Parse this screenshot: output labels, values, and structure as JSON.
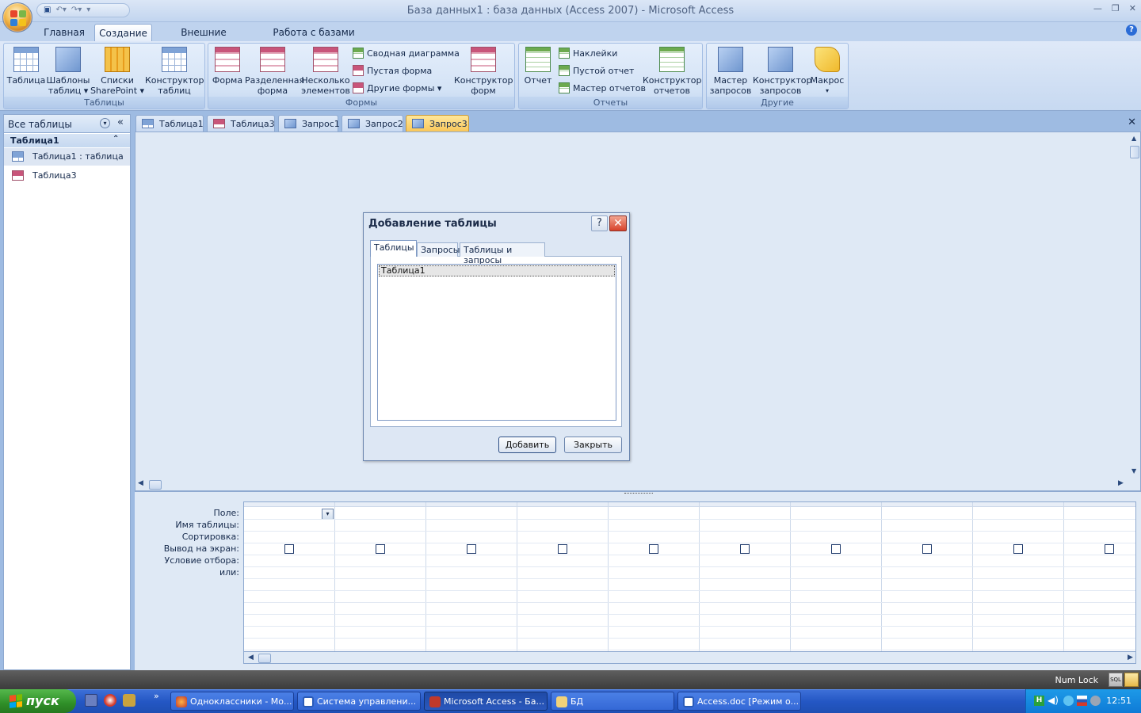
{
  "window": {
    "title": "База данных1 : база данных (Access 2007) - Microsoft Access"
  },
  "ribbon_tabs": [
    "Главная",
    "Создание",
    "Внешние данные",
    "Работа с базами данных"
  ],
  "groups": {
    "tables": {
      "label": "Таблицы",
      "btn_table": [
        "Таблица",
        ""
      ],
      "btn_templates": [
        "Шаблоны",
        "таблиц ▾"
      ],
      "btn_sharepoint": [
        "Списки",
        "SharePoint ▾"
      ],
      "btn_designer": [
        "Конструктор",
        "таблиц"
      ]
    },
    "forms": {
      "label": "Формы",
      "btn_form": [
        "Форма",
        ""
      ],
      "btn_split": [
        "Разделенная",
        "форма"
      ],
      "btn_multi": [
        "Несколько",
        "элементов"
      ],
      "pivot_chart": "Сводная диаграмма",
      "blank_form": "Пустая форма",
      "more_forms": "Другие формы ▾",
      "btn_form_designer": [
        "Конструктор",
        "форм"
      ]
    },
    "reports": {
      "label": "Отчеты",
      "btn_report": [
        "Отчет",
        ""
      ],
      "labels": "Наклейки",
      "blank_report": "Пустой отчет",
      "report_wizard": "Мастер отчетов",
      "btn_report_designer": [
        "Конструктор",
        "отчетов"
      ]
    },
    "other": {
      "label": "Другие",
      "btn_query_wizard": [
        "Мастер",
        "запросов"
      ],
      "btn_query_designer": [
        "Конструктор",
        "запросов"
      ],
      "btn_macro": [
        "Макрос",
        "▾"
      ]
    }
  },
  "nav": {
    "header": "Все таблицы",
    "group": "Таблица1",
    "items": [
      "Таблица1 : таблица",
      "Таблица3"
    ]
  },
  "doc_tabs": [
    "Таблица1",
    "Таблица3",
    "Запрос1",
    "Запрос2",
    "Запрос3"
  ],
  "grid": {
    "row_labels": [
      "Поле:",
      "Имя таблицы:",
      "Сортировка:",
      "Вывод на экран:",
      "Условие отбора:",
      "или:"
    ]
  },
  "dialog": {
    "title": "Добавление таблицы",
    "tabs": [
      "Таблицы",
      "Запросы",
      "Таблицы и запросы"
    ],
    "list_items": [
      "Таблица1"
    ],
    "add_button": "Добавить",
    "close_button": "Закрыть"
  },
  "status": {
    "numlock": "Num Lock"
  },
  "taskbar": {
    "start": "пуск",
    "buttons": [
      "Одноклассники - Мо...",
      "Система управлени...",
      "Microsoft Access - Ба...",
      "БД",
      "Access.doc [Режим о..."
    ],
    "clock": "12:51"
  },
  "colors": {
    "active_doc_tab": "#f9c75a",
    "ribbon_bg": "#d4e3f6",
    "taskbar": "#2457c4",
    "start_green": "#2f8f28"
  }
}
